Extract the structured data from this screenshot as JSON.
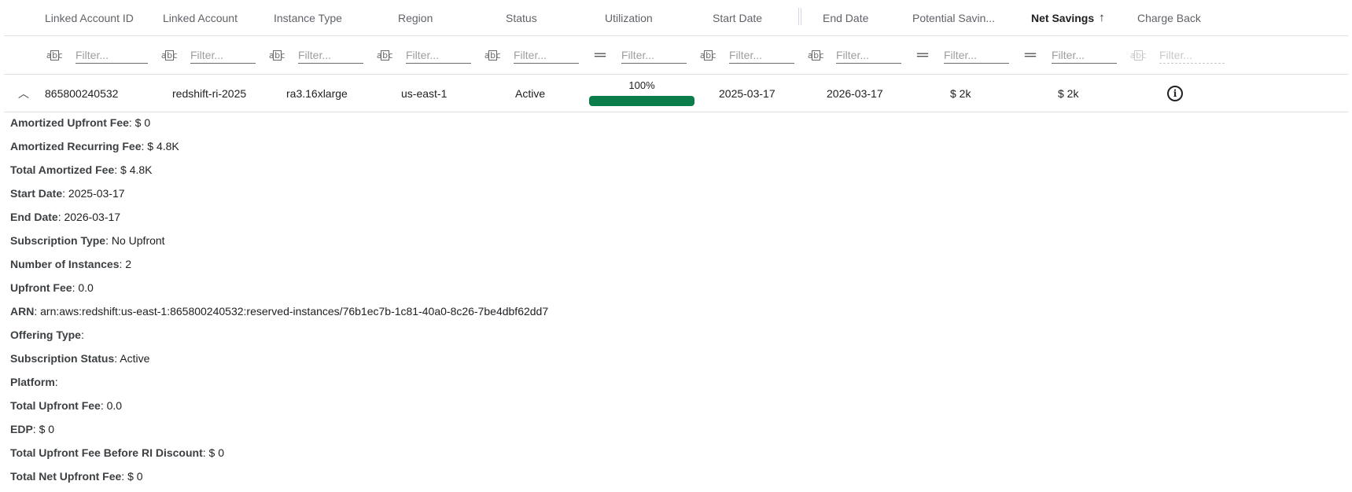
{
  "columns": [
    {
      "label": "Linked Account ID"
    },
    {
      "label": "Linked Account"
    },
    {
      "label": "Instance Type"
    },
    {
      "label": "Region"
    },
    {
      "label": "Status"
    },
    {
      "label": "Utilization"
    },
    {
      "label": "Start Date"
    },
    {
      "label": "End Date"
    },
    {
      "label": "Potential Savin..."
    },
    {
      "label": "Net Savings",
      "sort": "ascending"
    },
    {
      "label": "Charge Back"
    }
  ],
  "filters": {
    "placeholder": "Filter...",
    "types": [
      "text",
      "text",
      "text",
      "text",
      "text",
      "number",
      "text",
      "text",
      "number",
      "number",
      "text-disabled"
    ]
  },
  "row": {
    "expanded": true,
    "linked_account_id": "865800240532",
    "linked_account": "redshift-ri-2025",
    "instance_type": "ra3.16xlarge",
    "region": "us-east-1",
    "status": "Active",
    "utilization_label": "100%",
    "utilization_fraction": 1.0,
    "start_date": "2025-03-17",
    "end_date": "2026-03-17",
    "potential_savings": "$ 2k",
    "net_savings": "$ 2k"
  },
  "details": [
    {
      "key": "Amortized Upfront Fee",
      "value": "$ 0"
    },
    {
      "key": "Amortized Recurring Fee",
      "value": "$ 4.8K"
    },
    {
      "key": "Total Amortized Fee",
      "value": "$ 4.8K"
    },
    {
      "key": "Start Date",
      "value": "2025-03-17"
    },
    {
      "key": "End Date",
      "value": "2026-03-17"
    },
    {
      "key": "Subscription Type",
      "value": "No Upfront"
    },
    {
      "key": "Number of Instances",
      "value": "2"
    },
    {
      "key": "Upfront Fee",
      "value": "0.0"
    },
    {
      "key": "ARN",
      "value": "arn:aws:redshift:us-east-1:865800240532:reserved-instances/76b1ec7b-1c81-40a0-8c26-7be4dbf62dd7"
    },
    {
      "key": "Offering Type",
      "value": ""
    },
    {
      "key": "Subscription Status",
      "value": "Active"
    },
    {
      "key": "Platform",
      "value": ""
    },
    {
      "key": "Total Upfront Fee",
      "value": "0.0"
    },
    {
      "key": "EDP",
      "value": "$ 0"
    },
    {
      "key": "Total Upfront Fee Before RI Discount",
      "value": "$ 0"
    },
    {
      "key": "Total Net Upfront Fee",
      "value": "$ 0"
    }
  ],
  "colors": {
    "utilization_bar": "#0a7d4a"
  }
}
